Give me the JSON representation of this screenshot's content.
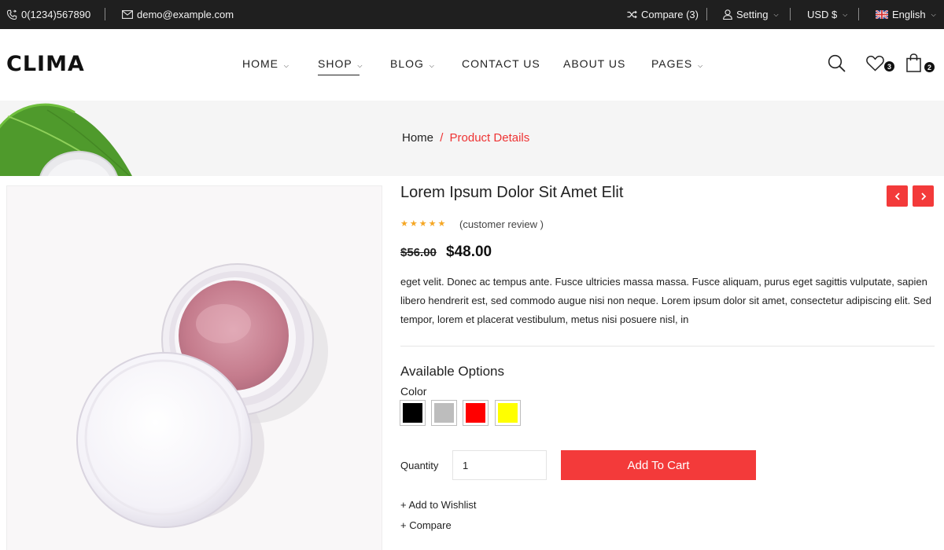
{
  "topbar": {
    "phone": "0(1234)567890",
    "email": "demo@example.com",
    "compare": "Compare (3)",
    "setting": "Setting",
    "currency": "USD $",
    "language": "English"
  },
  "header": {
    "logo": "CLIMA",
    "nav": [
      {
        "label": "HOME",
        "dropdown": true
      },
      {
        "label": "SHOP",
        "dropdown": true,
        "active": true
      },
      {
        "label": "BLOG",
        "dropdown": true
      },
      {
        "label": "CONTACT US",
        "dropdown": false
      },
      {
        "label": "ABOUT US",
        "dropdown": false
      },
      {
        "label": "PAGES",
        "dropdown": true
      }
    ],
    "wishlist_count": "3",
    "cart_count": "2"
  },
  "breadcrumb": {
    "home": "Home",
    "separator": "/",
    "current": "Product Details"
  },
  "product": {
    "title": "Lorem Ipsum Dolor Sit Amet Elit",
    "rating": 5,
    "stars": "★★★★★",
    "review_text": "(customer review )",
    "old_price": "$56.00",
    "price": "$48.00",
    "description": "eget velit. Donec ac tempus ante. Fusce ultricies massa massa. Fusce aliquam, purus eget sagittis vulputate, sapien libero hendrerit est, sed commodo augue nisi non neque. Lorem ipsum dolor sit amet, consectetur adipiscing elit. Sed tempor, lorem et placerat vestibulum, metus nisi posuere nisl, in",
    "options_title": "Available Options",
    "color_label": "Color",
    "colors": [
      "#000000",
      "#bdbdbd",
      "#ff0000",
      "#ffff00"
    ],
    "quantity_label": "Quantity",
    "quantity_value": "1",
    "add_to_cart": "Add To Cart",
    "wishlist_link": "+ Add to Wishlist",
    "compare_link": "+ Compare"
  },
  "colors": {
    "accent": "#f33a3a",
    "topbar_bg": "#1f1f1f",
    "band_bg": "#f5f5f5",
    "star": "#f5a623"
  },
  "icons": {
    "phone": "phone-icon",
    "email": "mail-icon",
    "compare": "shuffle-icon",
    "setting": "user-icon",
    "language": "uk-flag-icon",
    "search": "search-icon",
    "wishlist": "heart-icon",
    "cart": "bag-icon",
    "prev": "chevron-left-icon",
    "next": "chevron-right-icon"
  }
}
